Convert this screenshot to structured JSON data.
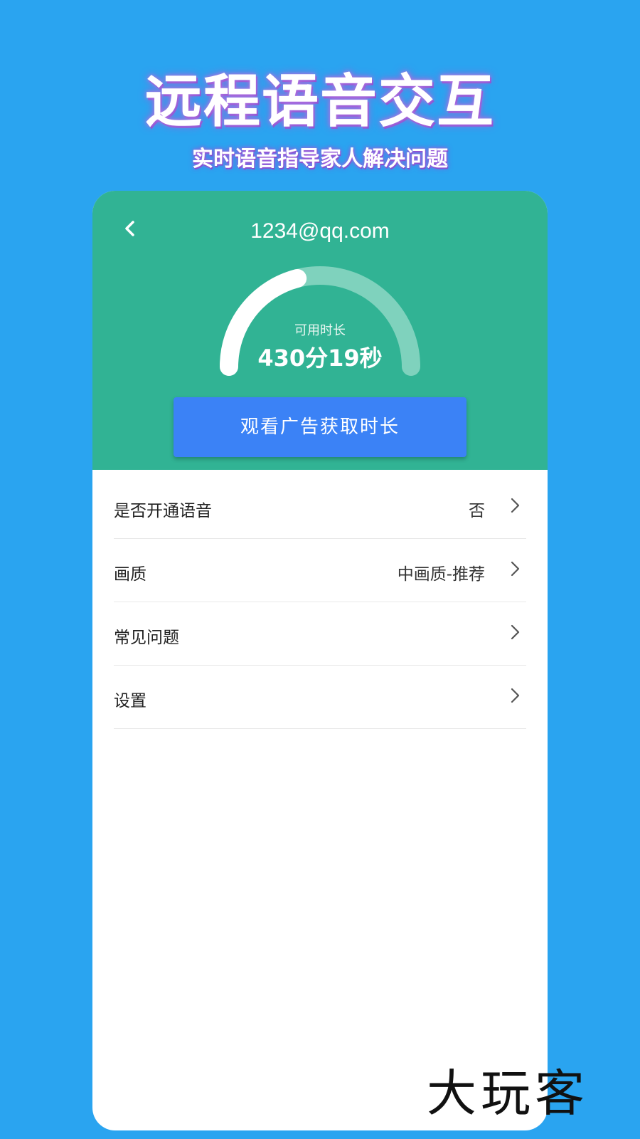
{
  "promo": {
    "title": "远程语音交互",
    "subtitle": "实时语音指导家人解决问题"
  },
  "header": {
    "account": "1234@qq.com",
    "back_icon": "chevron-left-icon"
  },
  "gauge": {
    "label": "可用时长",
    "value": "430分19秒",
    "fill_fraction": 0.42,
    "track_color": "#7fd2bd",
    "fill_color": "#ffffff"
  },
  "actions": {
    "watch_ad": "观看广告获取时长"
  },
  "settings": {
    "items": [
      {
        "label": "是否开通语音",
        "value": "否"
      },
      {
        "label": "画质",
        "value": "中画质-推荐"
      },
      {
        "label": "常见问题",
        "value": ""
      },
      {
        "label": "设置",
        "value": ""
      }
    ]
  },
  "colors": {
    "background": "#2aa4f0",
    "header_green": "#31b394",
    "button_blue": "#3b82f6"
  },
  "watermark": {
    "text": "大玩客"
  }
}
